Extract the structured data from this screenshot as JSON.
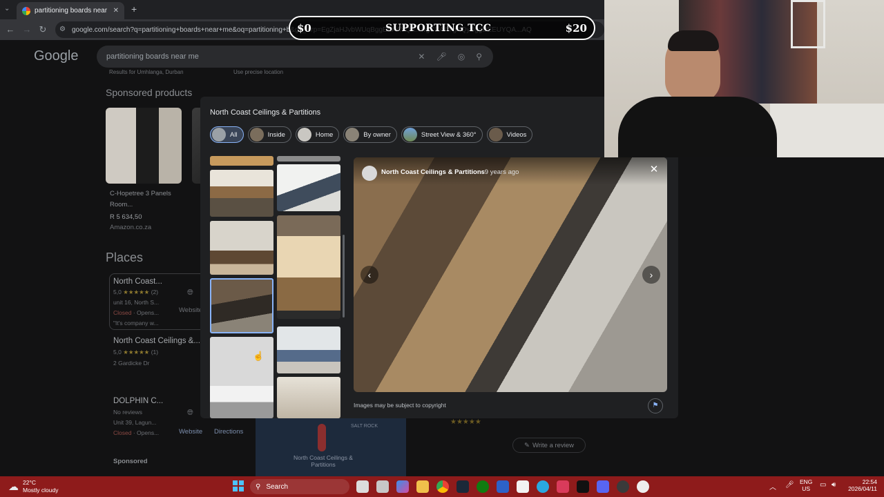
{
  "browser": {
    "tab_title": "partitioning boards near me - G",
    "url": "google.com/search?q=partitioning+boards+near+me&oq=partitioning+b&gs_lcrp=EgZjaHJvbWUqBggEEAAYQA...wgCEAAYgAQyBggDEEUYQA...AQ"
  },
  "stream_banner": {
    "left": "$0",
    "center": "SUPPORTING TCC",
    "right": "$20"
  },
  "google": {
    "logo": "Google",
    "query": "partitioning boards near me",
    "sponsored_products_heading": "Sponsored products",
    "location_hint": "Results for Umhlanga, Durban",
    "precise_location": "Use precise location",
    "products": [
      {
        "name": "C-Hopetree 3 Panels Room...",
        "price": "R 5 634,50",
        "store": "Amazon.co.za"
      }
    ],
    "places_heading": "Places",
    "places": [
      {
        "name": "North Coast...",
        "rating": "5,0",
        "stars": "★★★★★",
        "count": "(2)",
        "address": "unit 16, North S...",
        "status": "Closed",
        "opens": "· Opens...",
        "snippet": "\"It's company w...",
        "website": "Website"
      },
      {
        "name": "North Coast Ceilings &...",
        "rating": "5,0",
        "stars": "★★★★★",
        "count": "(1)",
        "address": "2 Gardicke Dr"
      },
      {
        "name": "DOLPHIN C...",
        "rating": "No reviews",
        "address": "Unit 39, Lagun...",
        "status": "Closed",
        "opens": "· Opens...",
        "website": "Website",
        "directions": "Directions"
      }
    ],
    "map_label": "North Coast Ceilings & Partitions",
    "map_place": "SALT ROCK",
    "write_review": "Write a review",
    "sponsored_label": "Sponsored"
  },
  "modal": {
    "title": "North Coast Ceilings & Partitions",
    "chips": [
      "All",
      "Inside",
      "Home",
      "By owner",
      "Street View & 360°",
      "Videos"
    ],
    "viewer_owner": "North Coast Ceilings & Partitions",
    "viewer_time": "· 9 years ago",
    "copyright": "Images may be subject to copyright"
  },
  "taskbar": {
    "temp": "22°C",
    "weather": "Mostly cloudy",
    "search": "Search",
    "lang": "ENG",
    "region": "US",
    "time": "22:54",
    "date": "2026/04/11"
  }
}
